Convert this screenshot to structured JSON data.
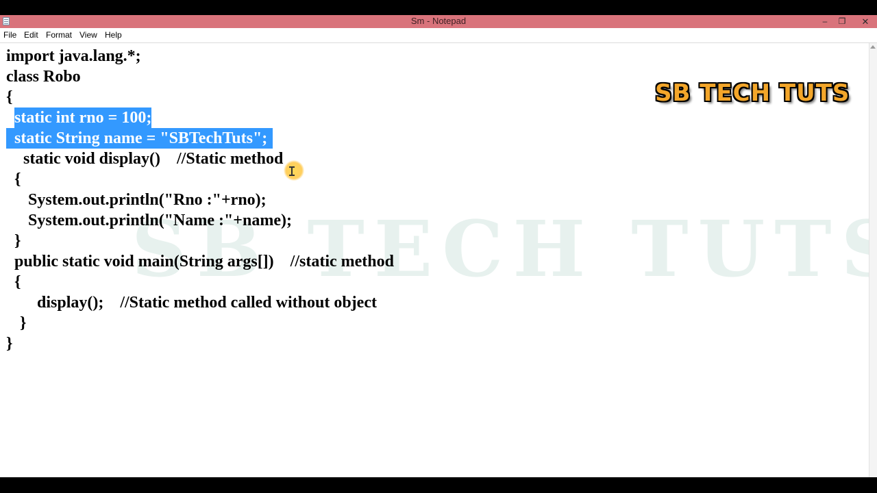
{
  "window": {
    "title": "Sm - Notepad",
    "controls": {
      "minimize": "–",
      "maximize": "❐",
      "close": "✕"
    }
  },
  "menu": {
    "items": [
      "File",
      "Edit",
      "Format",
      "View",
      "Help"
    ]
  },
  "editor": {
    "lines": [
      "import java.lang.*;",
      "class Robo",
      "{",
      "static int rno = 100;",
      "static String name = \"SBTechTuts\";",
      "static void display()    //Static method",
      "{",
      "System.out.println(\"Rno :\"+rno);",
      "System.out.println(\"Name :\"+name);",
      "}",
      "public static void main(String args[])    //static method",
      "{",
      "display();    //Static method called without object",
      "}",
      "}"
    ],
    "selected_lines": [
      4,
      5
    ],
    "selection_color": "#3399ff"
  },
  "logo": {
    "text": "SB TECH TUTS",
    "color": "#f3a62a"
  },
  "watermark": {
    "text": "SB TECH TUTS"
  },
  "colors": {
    "titlebar": "#d9737b",
    "editor_bg": "#ffffff"
  }
}
